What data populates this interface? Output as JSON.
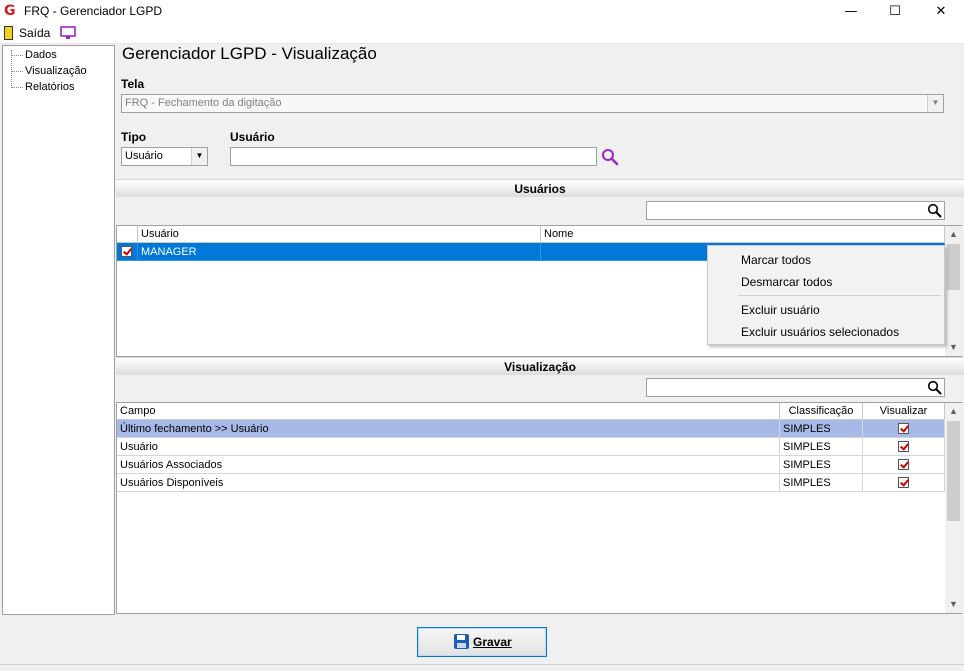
{
  "window": {
    "title": "FRQ - Gerenciador LGPD",
    "app_icon_glyph": "G",
    "minimize_glyph": "—",
    "maximize_glyph": "☐",
    "close_glyph": "✕"
  },
  "toolbar": {
    "exit_label": "Saída",
    "exit_icon": "exit-door-icon",
    "monitor_icon": "monitor-icon"
  },
  "sidebar": {
    "items": [
      {
        "label": "Dados"
      },
      {
        "label": "Visualização"
      },
      {
        "label": "Relatórios"
      }
    ]
  },
  "main": {
    "title": "Gerenciador LGPD - Visualização",
    "tela_label": "Tela",
    "tela_value": "FRQ - Fechamento da digitação",
    "tipo_label": "Tipo",
    "tipo_value": "Usuário",
    "usuario_label": "Usuário",
    "usuario_value": ""
  },
  "usuarios": {
    "section_title": "Usuários",
    "search_value": "",
    "columns": [
      "Usuário",
      "Nome"
    ],
    "rows": [
      {
        "checked": true,
        "usuario": "MANAGER",
        "nome": ""
      }
    ]
  },
  "context_menu": {
    "items": [
      "Marcar todos",
      "Desmarcar todos",
      "Excluir usuário",
      "Excluir usuários selecionados"
    ]
  },
  "visualizacao": {
    "section_title": "Visualização",
    "search_value": "",
    "columns": [
      "Campo",
      "Classificação",
      "Visualizar"
    ],
    "rows": [
      {
        "campo": "Último fechamento >> Usuário",
        "classificacao": "SIMPLES",
        "visualizar": true
      },
      {
        "campo": "Usuário",
        "classificacao": "SIMPLES",
        "visualizar": true
      },
      {
        "campo": "Usuários Associados",
        "classificacao": "SIMPLES",
        "visualizar": true
      },
      {
        "campo": "Usuários Disponíveis",
        "classificacao": "SIMPLES",
        "visualizar": true
      }
    ]
  },
  "buttons": {
    "save_label": "Gravar"
  },
  "colors": {
    "selection_blue": "#0078d7",
    "selection_light": "#a6b9e7",
    "accent_purple": "#9b27c8",
    "brand_red": "#d71920"
  }
}
